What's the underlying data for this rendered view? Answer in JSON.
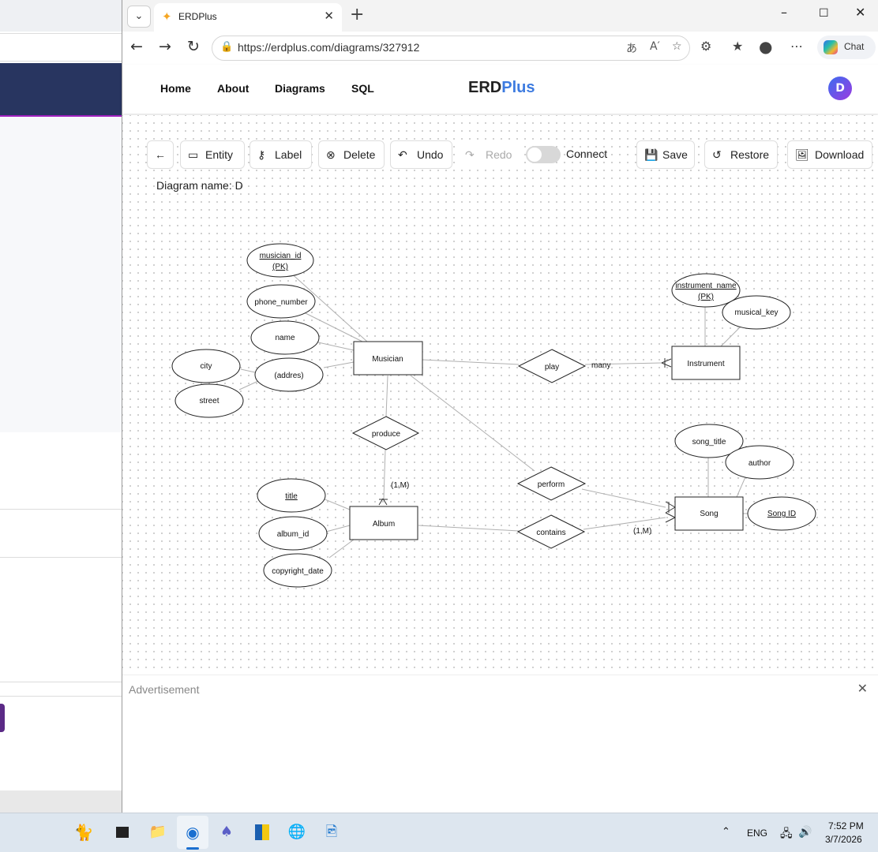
{
  "browser": {
    "tab_title": "ERDPlus",
    "url": "https://erdplus.com/diagrams/327912",
    "chat_label": "Chat"
  },
  "site": {
    "nav": [
      "Home",
      "About",
      "Diagrams",
      "SQL"
    ],
    "brand_part1": "ERD",
    "brand_part2": "Plus",
    "avatar_initial": "D"
  },
  "toolbar": {
    "entity": "Entity",
    "label": "Label",
    "delete": "Delete",
    "undo": "Undo",
    "redo": "Redo",
    "connect": "Connect",
    "save": "Save",
    "restore": "Restore",
    "download": "Download"
  },
  "diagram_name": "Diagram name: D",
  "erd": {
    "entities": {
      "musician": "Musician",
      "instrument": "Instrument",
      "album": "Album",
      "song": "Song"
    },
    "relationships": {
      "play": "play",
      "produce": "produce",
      "perform": "perform",
      "contains": "contains"
    },
    "attributes": {
      "musician_id": "musician_id",
      "musician_pk": "(PK)",
      "phone_number": "phone_number",
      "name": "name",
      "address": "(addres)",
      "city": "city",
      "street": "street",
      "instrument_name": "instrument_name",
      "instrument_pk": "(PK)",
      "musical_key": "musical_key",
      "song_title": "song_title",
      "author": "author",
      "song_id": "Song ID",
      "title": "title",
      "album_id": "album_id",
      "copyright_date": "copyright_date"
    },
    "cardinality": {
      "many": "many",
      "produce_card": "(1,M)",
      "contains_card": "(1,M)"
    }
  },
  "ad": {
    "label": "Advertisement"
  },
  "taskbar": {
    "lang": "ENG",
    "time": "7:52 PM",
    "date": "3/7/2026"
  }
}
